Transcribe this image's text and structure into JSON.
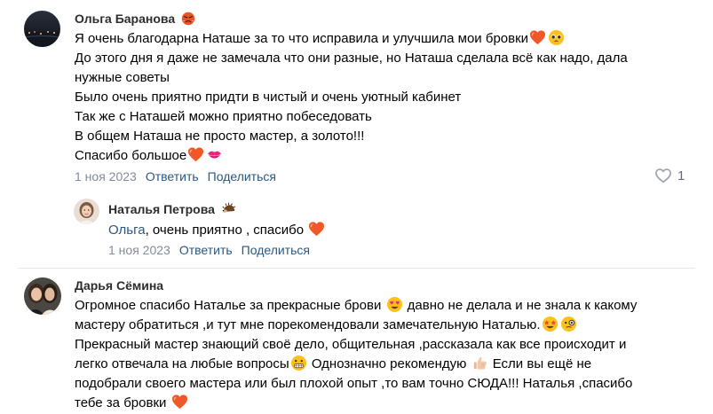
{
  "comments": [
    {
      "author": "Ольга Баранова",
      "author_badge_icon": "angry-face-emoji",
      "lines": [
        "Я очень благодарна Наташе за то что исправила и улучшила мои бровки",
        "До этого дня я даже не замечала что они разные, но Наташа сделала всё как надо, дала",
        "нужные советы",
        "Было очень приятно придти в чистый и очень уютный кабинет",
        "Так же с Наташей можно приятно побеседовать",
        "В общем Наташа не просто мастер, а золото!!!",
        "Спасибо большое"
      ],
      "date": "1 ноя 2023",
      "reply_label": "Ответить",
      "share_label": "Поделиться",
      "likes_count": "1"
    },
    {
      "author": "Наталья Петрова",
      "author_badge_icon": "hedgehog-emoji",
      "mention": "Ольга",
      "text": ", очень приятно , спасибо",
      "date": "1 ноя 2023",
      "reply_label": "Ответить",
      "share_label": "Поделиться"
    },
    {
      "author": "Дарья Сёмина",
      "lines": [
        "Огромное спасибо Наталье за прекрасные брови",
        "давно не делала и не знала к какому",
        "мастеру обратиться ,и тут мне порекомендовали замечательную Наталью.",
        "Прекрасный мастер знающий своё дело, общительная ,рассказала как все происходит и",
        "легко отвечала на любые вопросы",
        "Однозначно рекомендую",
        "Если вы ещё не",
        "подобрали своего мастера или был плохой опыт ,то вам точно СЮДА!!! Наталья ,спасибо",
        "тебе за бровки"
      ]
    }
  ],
  "colors": {
    "link": "#2a5885",
    "meta": "#818c99",
    "author": "#2c2d2e",
    "separator": "#e7e8ec"
  }
}
